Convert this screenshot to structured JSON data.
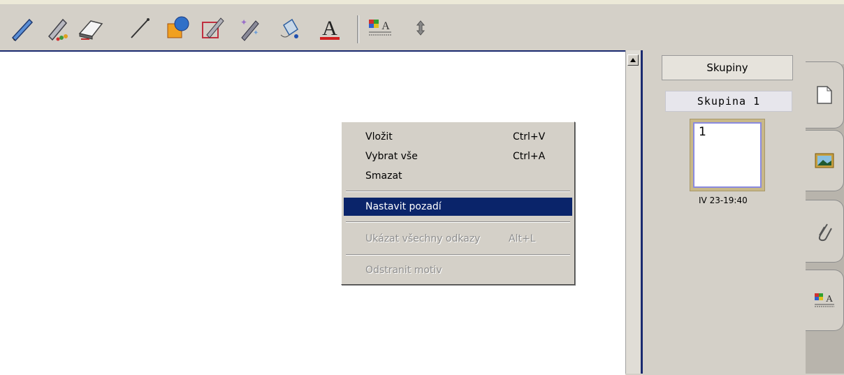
{
  "toolbar": {
    "tools": [
      {
        "icon": "pen-icon"
      },
      {
        "icon": "highlighter-icon"
      },
      {
        "icon": "eraser-icon"
      },
      {
        "icon": "line-icon"
      },
      {
        "icon": "shapes-icon"
      },
      {
        "icon": "shape-recognition-icon"
      },
      {
        "icon": "magic-pen-icon"
      },
      {
        "icon": "fill-icon"
      },
      {
        "icon": "text-icon",
        "glyph": "A"
      },
      {
        "icon": "table-text-icon"
      },
      {
        "icon": "move-icon",
        "glyph": "↕"
      }
    ]
  },
  "context_menu": {
    "items": [
      {
        "label": "Vložit",
        "shortcut": "Ctrl+V",
        "state": "normal"
      },
      {
        "label": "Vybrat vše",
        "shortcut": "Ctrl+A",
        "state": "normal"
      },
      {
        "label": "Smazat",
        "shortcut": "",
        "state": "normal"
      },
      {
        "label": "Nastavit pozadí",
        "shortcut": "",
        "state": "highlighted"
      },
      {
        "label": "Ukázat všechny odkazy",
        "shortcut": "Alt+L",
        "state": "disabled"
      },
      {
        "label": "Odstranit motiv",
        "shortcut": "",
        "state": "disabled"
      }
    ]
  },
  "sorter": {
    "groups_button": "Skupiny",
    "group_name": "Skupina 1",
    "page_number": "1",
    "page_timestamp": "IV 23-19:40"
  },
  "side_tabs": [
    {
      "icon": "page-sorter-icon"
    },
    {
      "icon": "gallery-icon"
    },
    {
      "icon": "attachments-icon"
    },
    {
      "icon": "properties-icon"
    }
  ],
  "colors": {
    "highlight": "#0a246a",
    "divider": "#1a2a70",
    "toolbar_bg": "#d4d0c8"
  }
}
